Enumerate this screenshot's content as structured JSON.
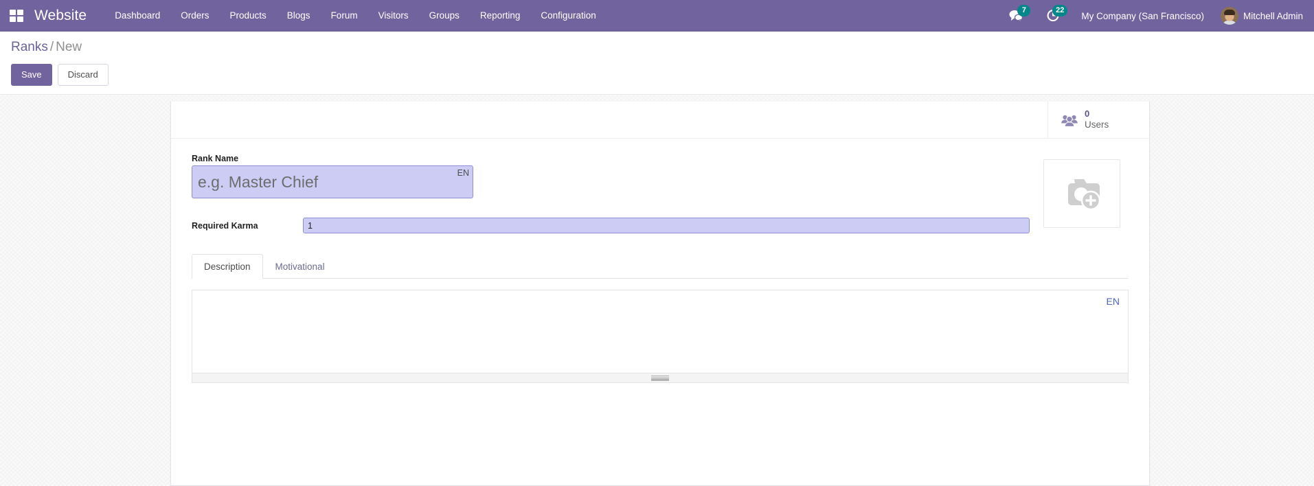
{
  "navbar": {
    "apps_icon": "apps-grid-icon",
    "brand": "Website",
    "menu_items": [
      {
        "label": "Dashboard"
      },
      {
        "label": "Orders"
      },
      {
        "label": "Products"
      },
      {
        "label": "Blogs"
      },
      {
        "label": "Forum"
      },
      {
        "label": "Visitors"
      },
      {
        "label": "Groups"
      },
      {
        "label": "Reporting"
      },
      {
        "label": "Configuration"
      }
    ],
    "messages": {
      "icon": "messages-icon",
      "count": "7"
    },
    "activities": {
      "icon": "clock-activity-icon",
      "count": "22"
    },
    "company": "My Company (San Francisco)",
    "user": {
      "name": "Mitchell Admin",
      "avatar": "user-avatar"
    }
  },
  "control_panel": {
    "breadcrumb": {
      "parent": "Ranks",
      "separator": "/",
      "current": "New"
    },
    "save_label": "Save",
    "discard_label": "Discard"
  },
  "form": {
    "smart_buttons": [
      {
        "icon": "users-group-icon",
        "value": "0",
        "label": "Users"
      }
    ],
    "rank_name": {
      "label": "Rank Name",
      "value": "",
      "placeholder": "e.g. Master Chief",
      "lang_badge": "EN"
    },
    "required_karma": {
      "label": "Required Karma",
      "value": "1",
      "placeholder": ""
    },
    "image": {
      "icon": "camera-add-icon",
      "alt": "Upload image"
    },
    "tabs": [
      {
        "label": "Description",
        "active": true
      },
      {
        "label": "Motivational",
        "active": false
      }
    ],
    "description_editor": {
      "content": "",
      "lang_badge": "EN",
      "resize_handle": "resize-grip-icon"
    }
  },
  "colors": {
    "brand_purple": "#71639e",
    "badge_teal": "#00878a",
    "field_focus_bg": "#ccccf5",
    "field_focus_border": "#8e8ed8",
    "smart_button_value": "#5c5191",
    "link_blue": "#4b64c4"
  }
}
